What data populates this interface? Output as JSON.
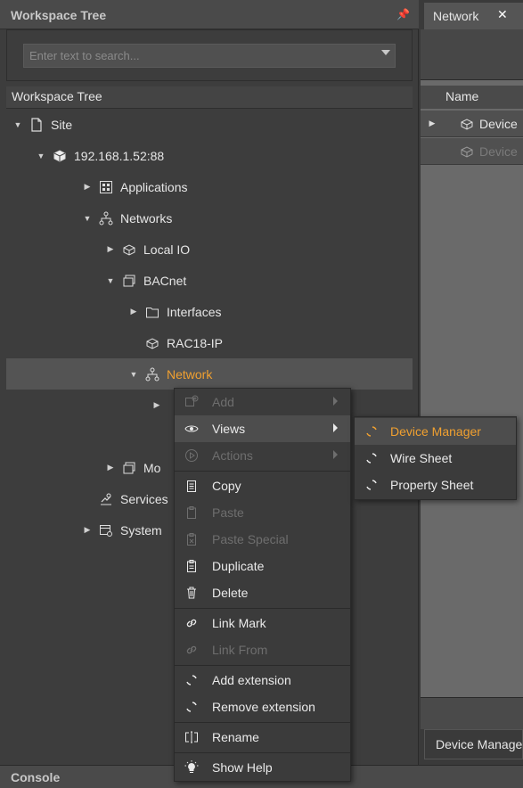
{
  "left_panel": {
    "title": "Workspace Tree",
    "pin_icon": "pin-icon",
    "search_placeholder": "Enter text to search...",
    "tree_header": "Workspace Tree",
    "tree": [
      {
        "label": "Site",
        "icon": "file-icon",
        "expanded": true
      },
      {
        "label": "192.168.1.52:88",
        "icon": "server-icon",
        "expanded": true
      },
      {
        "label": "Applications",
        "icon": "applications-icon",
        "expanded": false
      },
      {
        "label": "Networks",
        "icon": "network-icon",
        "expanded": true
      },
      {
        "label": "Local IO",
        "icon": "device-icon",
        "expanded": false
      },
      {
        "label": "BACnet",
        "icon": "bacnet-icon",
        "expanded": true
      },
      {
        "label": "Interfaces",
        "icon": "folder-icon",
        "expanded": false
      },
      {
        "label": "RAC18-IP",
        "icon": "device-icon",
        "expanded": null
      },
      {
        "label": "Network",
        "icon": "network-icon",
        "expanded": true,
        "selected": true,
        "accent": "#f0a030"
      },
      {
        "label": "Mo",
        "icon": "bacnet-icon",
        "expanded": false
      },
      {
        "label": "Services",
        "icon": "services-icon",
        "expanded": null
      },
      {
        "label": "System",
        "icon": "system-icon",
        "expanded": false
      }
    ]
  },
  "right_panel": {
    "tab_label": "Network",
    "grid_header": "Name",
    "rows": [
      {
        "label": "Device",
        "disabled": false
      },
      {
        "label": "Device",
        "disabled": true
      }
    ],
    "bottom_tab": "Device Manage"
  },
  "console": {
    "title": "Console"
  },
  "context_menu": {
    "items": [
      {
        "label": "Add",
        "icon": "add-icon",
        "disabled": true,
        "submenu": true
      },
      {
        "label": "Views",
        "icon": "eye-icon",
        "disabled": false,
        "submenu": true,
        "highlighted": true
      },
      {
        "label": "Actions",
        "icon": "play-icon",
        "disabled": true,
        "submenu": true
      },
      {
        "label": "Copy",
        "icon": "copy-icon",
        "disabled": false
      },
      {
        "label": "Paste",
        "icon": "paste-icon",
        "disabled": true
      },
      {
        "label": "Paste Special",
        "icon": "paste-special-icon",
        "disabled": true
      },
      {
        "label": "Duplicate",
        "icon": "duplicate-icon",
        "disabled": false
      },
      {
        "label": "Delete",
        "icon": "trash-icon",
        "disabled": false
      },
      {
        "label": "Link Mark",
        "icon": "link-icon",
        "disabled": false
      },
      {
        "label": "Link From",
        "icon": "link-icon",
        "disabled": true
      },
      {
        "label": "Add extension",
        "icon": "loader-icon",
        "disabled": false
      },
      {
        "label": "Remove extension",
        "icon": "loader-icon",
        "disabled": false
      },
      {
        "label": "Rename",
        "icon": "rename-icon",
        "disabled": false
      },
      {
        "label": "Show Help",
        "icon": "lightbulb-icon",
        "disabled": false
      }
    ]
  },
  "views_submenu": {
    "items": [
      {
        "label": "Device Manager",
        "icon": "loader-icon",
        "highlighted": true
      },
      {
        "label": "Wire Sheet",
        "icon": "loader-icon"
      },
      {
        "label": "Property Sheet",
        "icon": "loader-icon"
      }
    ]
  },
  "colors": {
    "accent": "#f0a030",
    "panel_bg": "#3d3d3d",
    "header_bg": "#4a4a4a",
    "disabled_text": "#6e6e6e"
  }
}
